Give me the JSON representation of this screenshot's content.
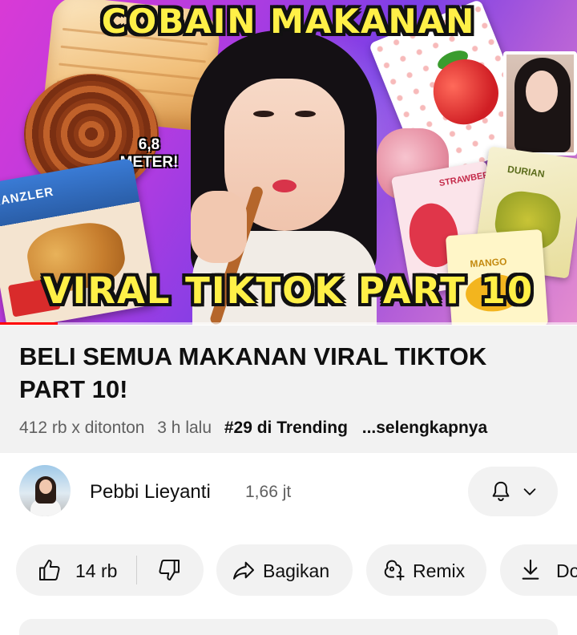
{
  "thumbnail": {
    "headline_top": "COBAIN MAKANAN",
    "headline_bottom": "VIRAL TIKTOK PART 10",
    "callout_line1": "6,8",
    "callout_line2": "METER!",
    "brand_label": "KANZLER",
    "pack_strawberry": "STRAWBERRY",
    "pack_durian": "DURIAN",
    "pack_mango": "MANGO",
    "progress": 0.1
  },
  "video": {
    "title": "BELI SEMUA MAKANAN VIRAL TIKTOK PART 10!",
    "views": "412 rb x ditonton",
    "age": "3 h lalu",
    "trending": "#29 di Trending",
    "more_label": "...selengkapnya"
  },
  "channel": {
    "name": "Pebbi Lieyanti",
    "subscribers": "1,66 jt",
    "bell_icon": "bell-icon",
    "dropdown_icon": "chevron-down-icon"
  },
  "actions": {
    "like_count": "14 rb",
    "share_label": "Bagikan",
    "remix_label": "Remix",
    "download_label": "Do"
  },
  "colors": {
    "accent": "#ff0000",
    "pill_bg": "#f2f2f2",
    "headline_yellow": "#fff047"
  }
}
